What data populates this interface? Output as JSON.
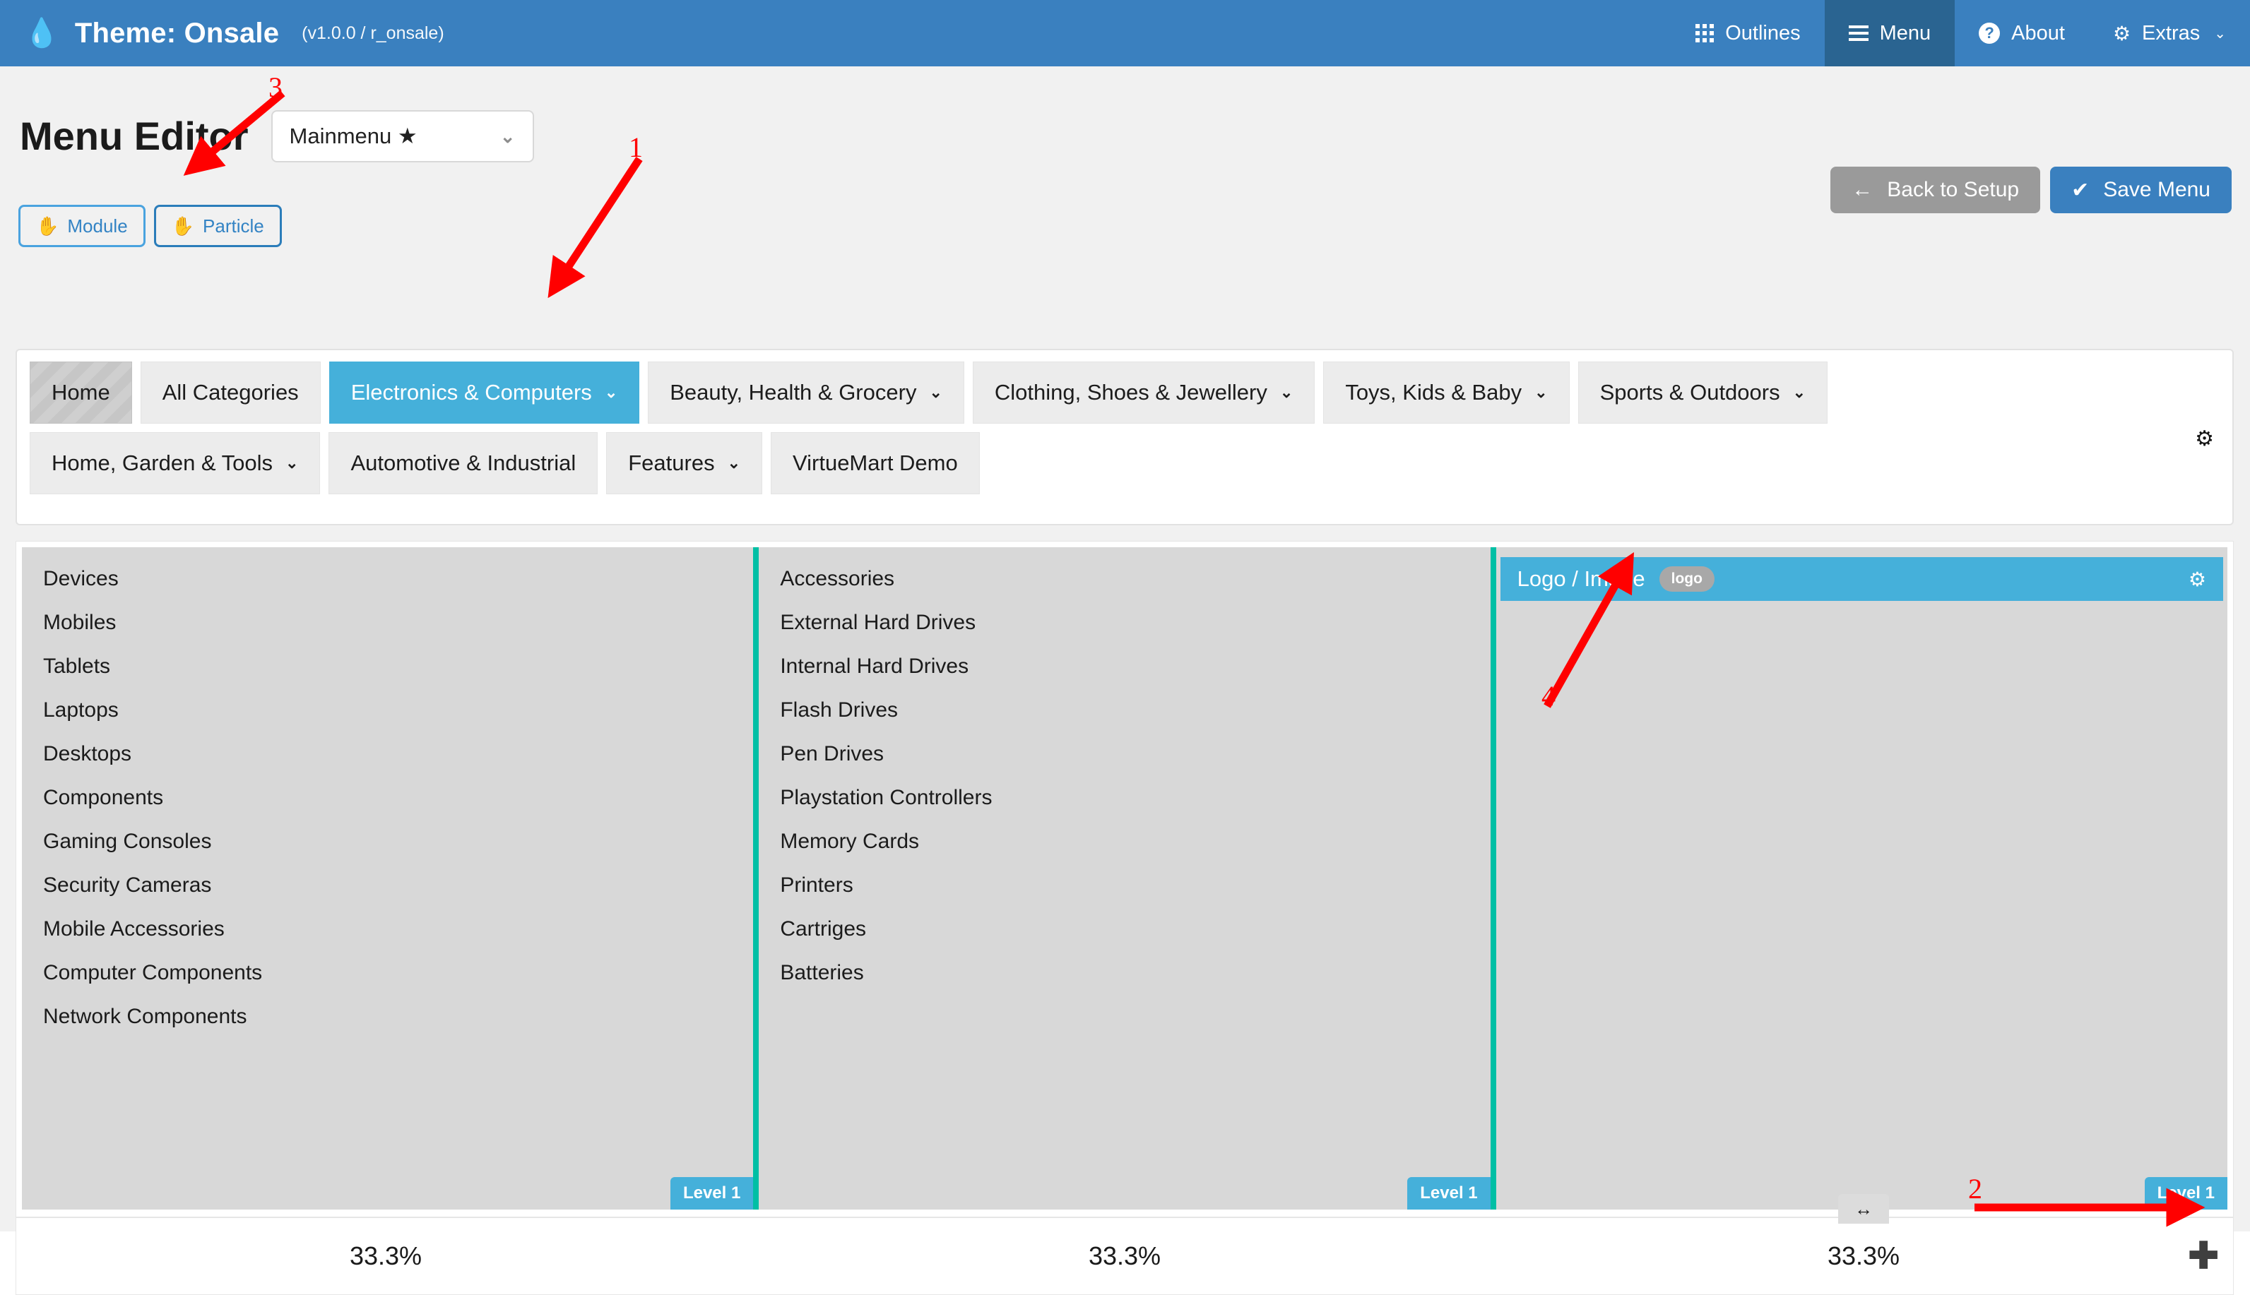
{
  "topbar": {
    "brand_icon": "water-drop-icon",
    "brand_title": "Theme: Onsale",
    "brand_version": "(v1.0.0 / r_onsale)",
    "nav": [
      {
        "label": "Outlines",
        "icon": "grid-icon",
        "active": false
      },
      {
        "label": "Menu",
        "icon": "hamburger-icon",
        "active": true
      },
      {
        "label": "About",
        "icon": "question-circle-icon",
        "active": false
      },
      {
        "label": "Extras",
        "icon": "gear-icon",
        "active": false,
        "caret": "⌄"
      }
    ],
    "bg_color": "#3a80bf",
    "active_bg_color": "#2a6491"
  },
  "header": {
    "page_title": "Menu Editor",
    "menu_select_value": "Mainmenu ★",
    "menu_select_caret": "⌄",
    "type_buttons": [
      {
        "label": "Module",
        "icon": "hand-icon",
        "selected": false
      },
      {
        "label": "Particle",
        "icon": "hand-icon",
        "selected": true
      }
    ],
    "back_button": {
      "label": "Back to Setup",
      "icon": "arrow-left-icon"
    },
    "save_button": {
      "label": "Save Menu",
      "icon": "check-icon"
    }
  },
  "menu_tabs": {
    "gear_icon": "gear-icon",
    "rows": [
      [
        {
          "label": "Home",
          "state": "home",
          "caret": ""
        },
        {
          "label": "All Categories",
          "state": "normal",
          "caret": ""
        },
        {
          "label": "Electronics & Computers",
          "state": "active",
          "caret": "⌄"
        },
        {
          "label": "Beauty, Health & Grocery",
          "state": "normal",
          "caret": "⌄"
        },
        {
          "label": "Clothing, Shoes & Jewellery",
          "state": "normal",
          "caret": "⌄"
        },
        {
          "label": "Toys, Kids & Baby",
          "state": "normal",
          "caret": "⌄"
        },
        {
          "label": "Sports & Outdoors",
          "state": "normal",
          "caret": "⌄"
        }
      ],
      [
        {
          "label": "Home, Garden & Tools",
          "state": "normal",
          "caret": "⌄"
        },
        {
          "label": "Automotive & Industrial",
          "state": "normal",
          "caret": ""
        },
        {
          "label": "Features",
          "state": "normal",
          "caret": "⌄"
        },
        {
          "label": "VirtueMart Demo",
          "state": "normal",
          "caret": ""
        }
      ]
    ]
  },
  "columns": [
    {
      "items": [
        "Devices",
        "Mobiles",
        "Tablets",
        "Laptops",
        "Desktops",
        "Components",
        "Gaming Consoles",
        "Security Cameras",
        "Mobile Accessories",
        "Computer Components",
        "Network Components"
      ],
      "level_badge": "Level 1",
      "width_percent": "33.3%",
      "particle": null
    },
    {
      "items": [
        "Accessories",
        "External Hard Drives",
        "Internal Hard Drives",
        "Flash Drives",
        "Pen Drives",
        "Playstation Controllers",
        "Memory Cards",
        "Printers",
        "Cartriges",
        "Batteries"
      ],
      "level_badge": "Level 1",
      "width_percent": "33.3%",
      "particle": null
    },
    {
      "items": [],
      "level_badge": "Level 1",
      "width_percent": "33.3%",
      "particle": {
        "title": "Logo / Image",
        "tag": "logo",
        "gear_icon": "gear-icon"
      }
    }
  ],
  "footer": {
    "resize_handle_icon": "↔",
    "add_icon": "✚"
  },
  "annotations": [
    {
      "number": "1",
      "target": "electronics-computers-tab"
    },
    {
      "number": "2",
      "target": "add-column-button"
    },
    {
      "number": "3",
      "target": "particle-type-button"
    },
    {
      "number": "4",
      "target": "logo-image-particle"
    }
  ],
  "colors": {
    "brand_blue": "#3a80bf",
    "accent_cyan": "#45b0da",
    "separator_teal": "#00bfa5",
    "annotation_red": "#ff0000",
    "column_bg": "#d8d8d8"
  }
}
